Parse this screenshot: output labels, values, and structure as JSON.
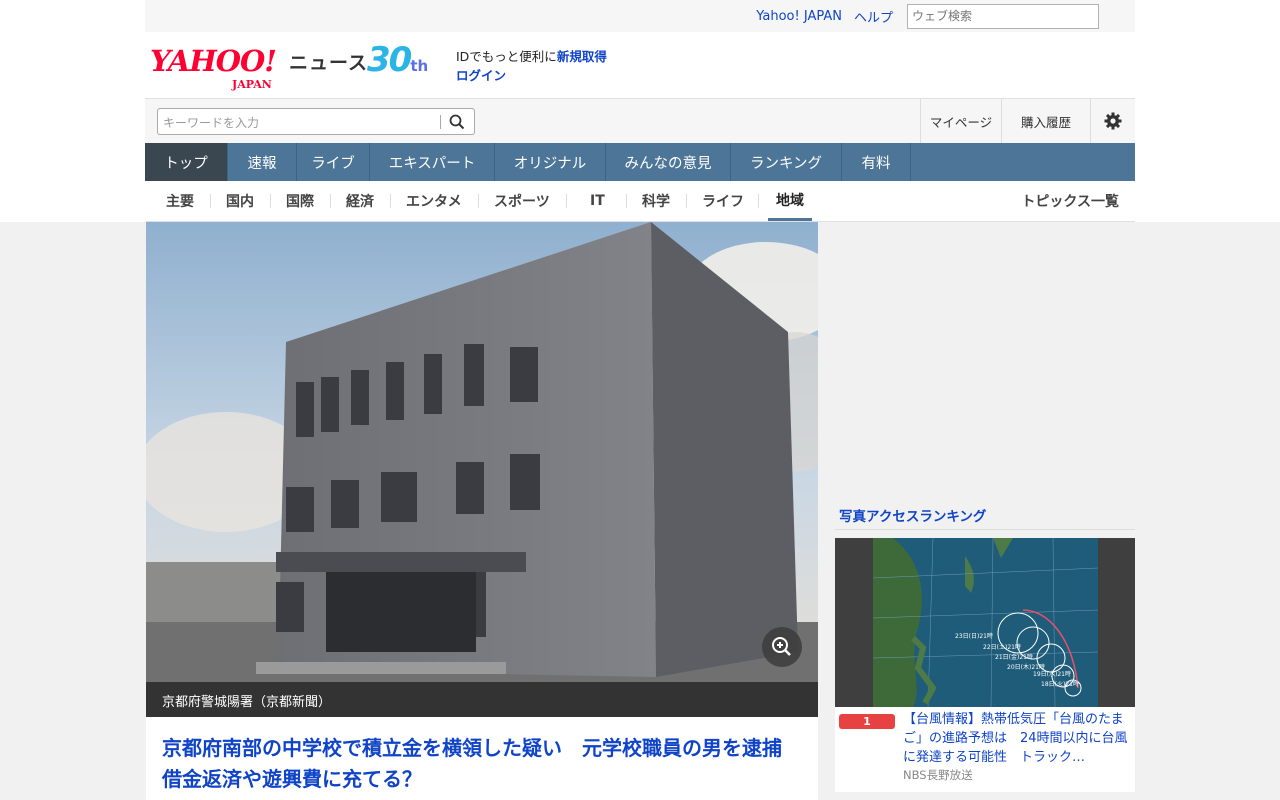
{
  "utility": {
    "links": [
      "Yahoo! JAPAN",
      "ヘルプ"
    ],
    "web_search_placeholder": "ウェブ検索"
  },
  "masthead": {
    "logo_text": "YAHOO!",
    "logo_sub": "JAPAN",
    "site_name": "ニュース",
    "anniversary_num": "30",
    "anniversary_suffix": "th",
    "id_prompt": "IDでもっと便利に",
    "signup": "新規取得",
    "login": "ログイン"
  },
  "search": {
    "placeholder": "キーワードを入力",
    "mypage": "マイページ",
    "purchase_history": "購入履歴"
  },
  "global_nav": [
    "トップ",
    "速報",
    "ライブ",
    "エキスパート",
    "オリジナル",
    "みんなの意見",
    "ランキング",
    "有料"
  ],
  "category_nav": {
    "items": [
      "主要",
      "国内",
      "国際",
      "経済",
      "エンタメ",
      "スポーツ",
      "IT",
      "科学",
      "ライフ",
      "地域"
    ],
    "active": "地域",
    "topics": "トピックス一覧"
  },
  "article": {
    "caption": "京都府警城陽署（京都新聞）",
    "headline": "京都府南部の中学校で積立金を横領した疑い　元学校職員の男を逮捕　借金返済や遊興費に充てる？"
  },
  "sidebar": {
    "ranking_title": "写真アクセスランキング",
    "items": [
      {
        "rank": "1",
        "title": "【台風情報】熱帯低気圧「台風のたまご」の進路予想は　24時間以内に台風に発達する可能性　トラック…",
        "source": "NBS長野放送"
      }
    ],
    "map_labels": [
      "23日(日)21時",
      "22日(土)21時",
      "21日(金)21時",
      "20日(木)21時",
      "19日(水)21時",
      "18日(火)21時"
    ]
  },
  "colors": {
    "link_blue": "#1044c8",
    "nav_blue": "#4c7597",
    "nav_active": "#3a4751",
    "yahoo_red": "#ff0033",
    "rank_red": "#e84141"
  }
}
